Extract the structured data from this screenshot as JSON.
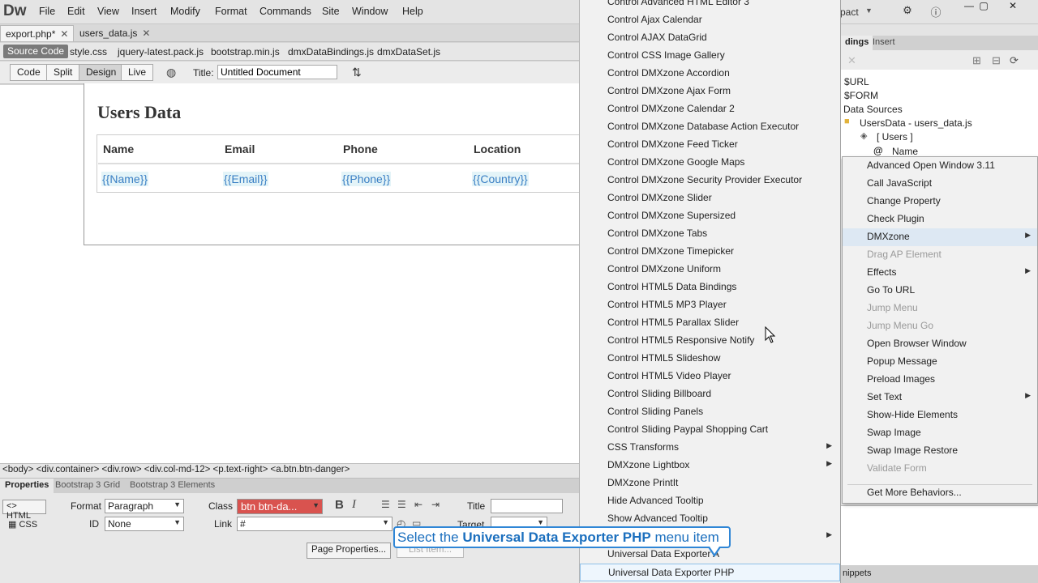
{
  "app": {
    "logo": "Dw",
    "menus": [
      "File",
      "Edit",
      "View",
      "Insert",
      "Modify",
      "Format",
      "Commands",
      "Site",
      "Window",
      "Help"
    ],
    "workspace": "pact"
  },
  "doc_tabs": [
    {
      "label": "export.php*",
      "close": "✕"
    },
    {
      "label": "users_data.js",
      "close": "✕"
    }
  ],
  "related_files": [
    "Source Code",
    "style.css",
    "jquery-latest.pack.js",
    "bootstrap.min.js",
    "dmxDataBindings.js",
    "dmxDataSet.js"
  ],
  "doc_toolbar": {
    "views": [
      "Code",
      "Split",
      "Design",
      "Live"
    ],
    "title_label": "Title:",
    "title_value": "Untitled Document"
  },
  "design": {
    "heading": "Users Data",
    "columns": [
      "Name",
      "Email",
      "Phone",
      "Location"
    ],
    "bindings": [
      "{{Name}}",
      "{{Email}}",
      "{{Phone}}",
      "{{Country}}"
    ]
  },
  "tag_selector": "<body> <div.container> <div.row> <div.col-md-12> <p.text-right> <a.btn.btn-danger>",
  "properties": {
    "tabs": [
      "Properties",
      "Bootstrap 3 Grid",
      "Bootstrap 3 Elements"
    ],
    "html_label": "HTML",
    "css_label": "CSS",
    "format_label": "Format",
    "format_value": "Paragraph",
    "id_label": "ID",
    "id_value": "None",
    "class_label": "Class",
    "class_value": "btn btn-da...",
    "link_label": "Link",
    "link_value": "#",
    "title_label": "Title",
    "target_label": "Target",
    "page_properties": "Page Properties...",
    "list_item": "List Item..."
  },
  "right_panel": {
    "tabs": [
      "dings",
      "Insert"
    ],
    "tree": [
      "$URL",
      "$FORM",
      "Data Sources",
      "UsersData - users_data.js",
      "[ Users ]",
      "Name"
    ],
    "snippets": "nippets"
  },
  "behaviors_menu": [
    {
      "label": "Advanced Open Window 3.11",
      "enabled": true,
      "submenu": false
    },
    {
      "label": "Call JavaScript",
      "enabled": true,
      "submenu": false
    },
    {
      "label": "Change Property",
      "enabled": true,
      "submenu": false
    },
    {
      "label": "Check Plugin",
      "enabled": true,
      "submenu": false
    },
    {
      "label": "DMXzone",
      "enabled": true,
      "submenu": true
    },
    {
      "label": "Drag AP Element",
      "enabled": false,
      "submenu": false
    },
    {
      "label": "Effects",
      "enabled": true,
      "submenu": true
    },
    {
      "label": "Go To URL",
      "enabled": true,
      "submenu": false
    },
    {
      "label": "Jump Menu",
      "enabled": false,
      "submenu": false
    },
    {
      "label": "Jump Menu Go",
      "enabled": false,
      "submenu": false
    },
    {
      "label": "Open Browser Window",
      "enabled": true,
      "submenu": false
    },
    {
      "label": "Popup Message",
      "enabled": true,
      "submenu": false
    },
    {
      "label": "Preload Images",
      "enabled": true,
      "submenu": false
    },
    {
      "label": "Set Text",
      "enabled": true,
      "submenu": true
    },
    {
      "label": "Show-Hide Elements",
      "enabled": true,
      "submenu": false
    },
    {
      "label": "Swap Image",
      "enabled": true,
      "submenu": false
    },
    {
      "label": "Swap Image Restore",
      "enabled": true,
      "submenu": false
    },
    {
      "label": "Validate Form",
      "enabled": false,
      "submenu": false
    },
    {
      "label": "Get More Behaviors...",
      "enabled": true,
      "submenu": false
    }
  ],
  "dmxzone_submenu": [
    {
      "label": "Control Advanced HTML Editor 3",
      "submenu": false
    },
    {
      "label": "Control Ajax Calendar",
      "submenu": false
    },
    {
      "label": "Control AJAX DataGrid",
      "submenu": false
    },
    {
      "label": "Control CSS Image Gallery",
      "submenu": false
    },
    {
      "label": "Control DMXzone Accordion",
      "submenu": false
    },
    {
      "label": "Control DMXzone Ajax Form",
      "submenu": false
    },
    {
      "label": "Control DMXzone Calendar 2",
      "submenu": false
    },
    {
      "label": "Control DMXzone Database Action Executor",
      "submenu": false
    },
    {
      "label": "Control DMXzone Feed Ticker",
      "submenu": false
    },
    {
      "label": "Control DMXzone Google Maps",
      "submenu": false
    },
    {
      "label": "Control DMXzone Security Provider Executor",
      "submenu": false
    },
    {
      "label": "Control DMXzone Slider",
      "submenu": false
    },
    {
      "label": "Control DMXzone Supersized",
      "submenu": false
    },
    {
      "label": "Control DMXzone Tabs",
      "submenu": false
    },
    {
      "label": "Control DMXzone Timepicker",
      "submenu": false
    },
    {
      "label": "Control DMXzone Uniform",
      "submenu": false
    },
    {
      "label": "Control HTML5 Data Bindings",
      "submenu": false
    },
    {
      "label": "Control HTML5 MP3 Player",
      "submenu": false
    },
    {
      "label": "Control HTML5 Parallax Slider",
      "submenu": false
    },
    {
      "label": "Control HTML5 Responsive Notify",
      "submenu": false
    },
    {
      "label": "Control HTML5 Slideshow",
      "submenu": false
    },
    {
      "label": "Control HTML5 Video Player",
      "submenu": false
    },
    {
      "label": "Control Sliding Billboard",
      "submenu": false
    },
    {
      "label": "Control Sliding Panels",
      "submenu": false
    },
    {
      "label": "Control Sliding Paypal Shopping Cart",
      "submenu": false
    },
    {
      "label": "CSS Transforms",
      "submenu": true
    },
    {
      "label": "DMXzone Lightbox",
      "submenu": true
    },
    {
      "label": "DMXzone PrintIt",
      "submenu": false
    },
    {
      "label": "Hide Advanced Tooltip",
      "submenu": false
    },
    {
      "label": "Show Advanced Tooltip",
      "submenu": false
    },
    {
      "label": "",
      "submenu": true
    },
    {
      "label": "Universal Data Exporter A",
      "submenu": false
    },
    {
      "label": "Universal Data Exporter PHP",
      "submenu": false
    }
  ],
  "callout": {
    "prefix": "Select the ",
    "bold": "Universal Data Exporter PHP",
    "suffix": " menu item"
  },
  "colors": {
    "accent": "#2f86d6",
    "danger": "#d9534f",
    "binding_text": "#3a7fc4"
  }
}
